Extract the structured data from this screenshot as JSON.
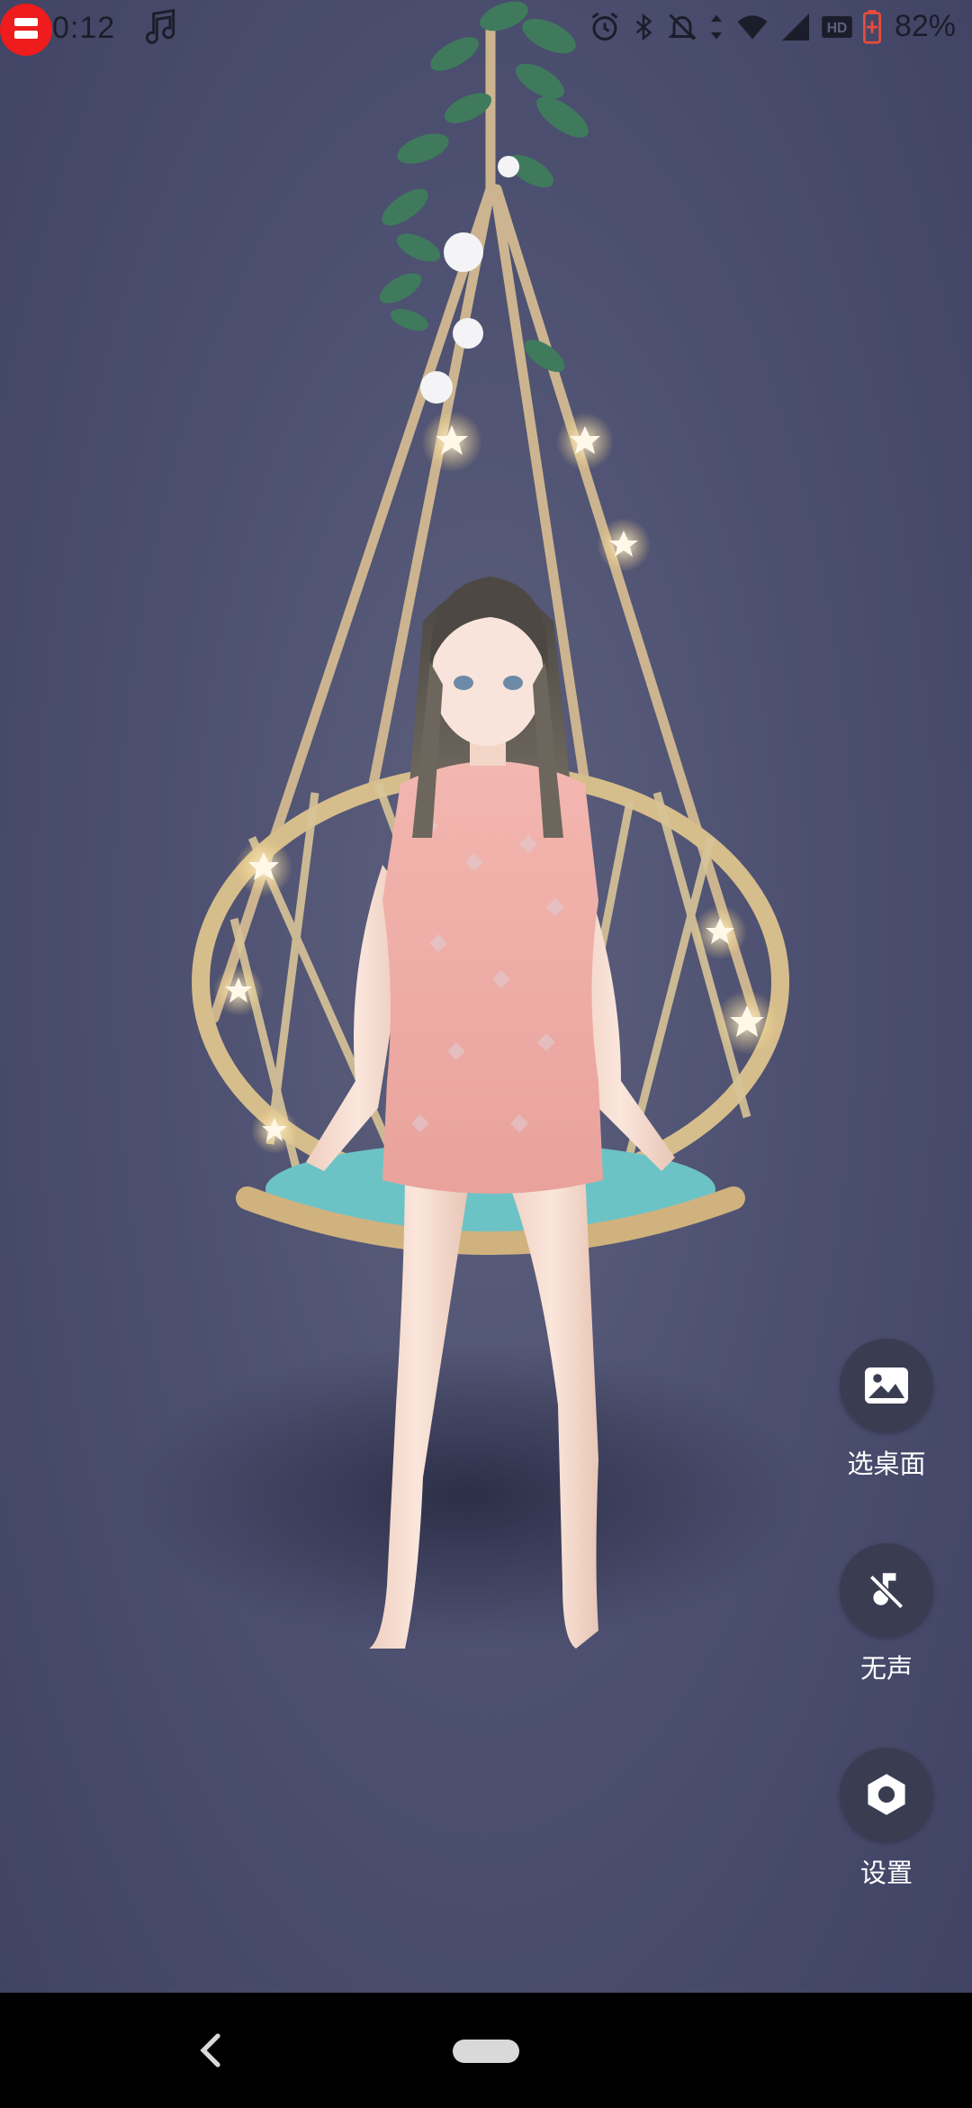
{
  "status_bar": {
    "time": "0:12",
    "battery_percent": "82%",
    "icons": [
      "music-note-icon",
      "alarm-icon",
      "bluetooth-icon",
      "notifications-off-icon",
      "data-arrows-icon",
      "wifi-icon",
      "cell-signal-icon",
      "hd-icon",
      "battery-charging-icon"
    ],
    "recording_indicator_color": "#ee1c1c"
  },
  "wallpaper": {
    "subject": "anime-girl-on-hanging-rattan-swing",
    "background_color": "#4d5070"
  },
  "actions": {
    "choose_wallpaper": {
      "label": "选桌面",
      "icon": "image-icon"
    },
    "mute": {
      "label": "无声",
      "icon": "music-off-icon"
    },
    "settings": {
      "label": "设置",
      "icon": "settings-icon"
    }
  },
  "nav_bar": {
    "icons": [
      "back-icon",
      "home-pill"
    ]
  }
}
